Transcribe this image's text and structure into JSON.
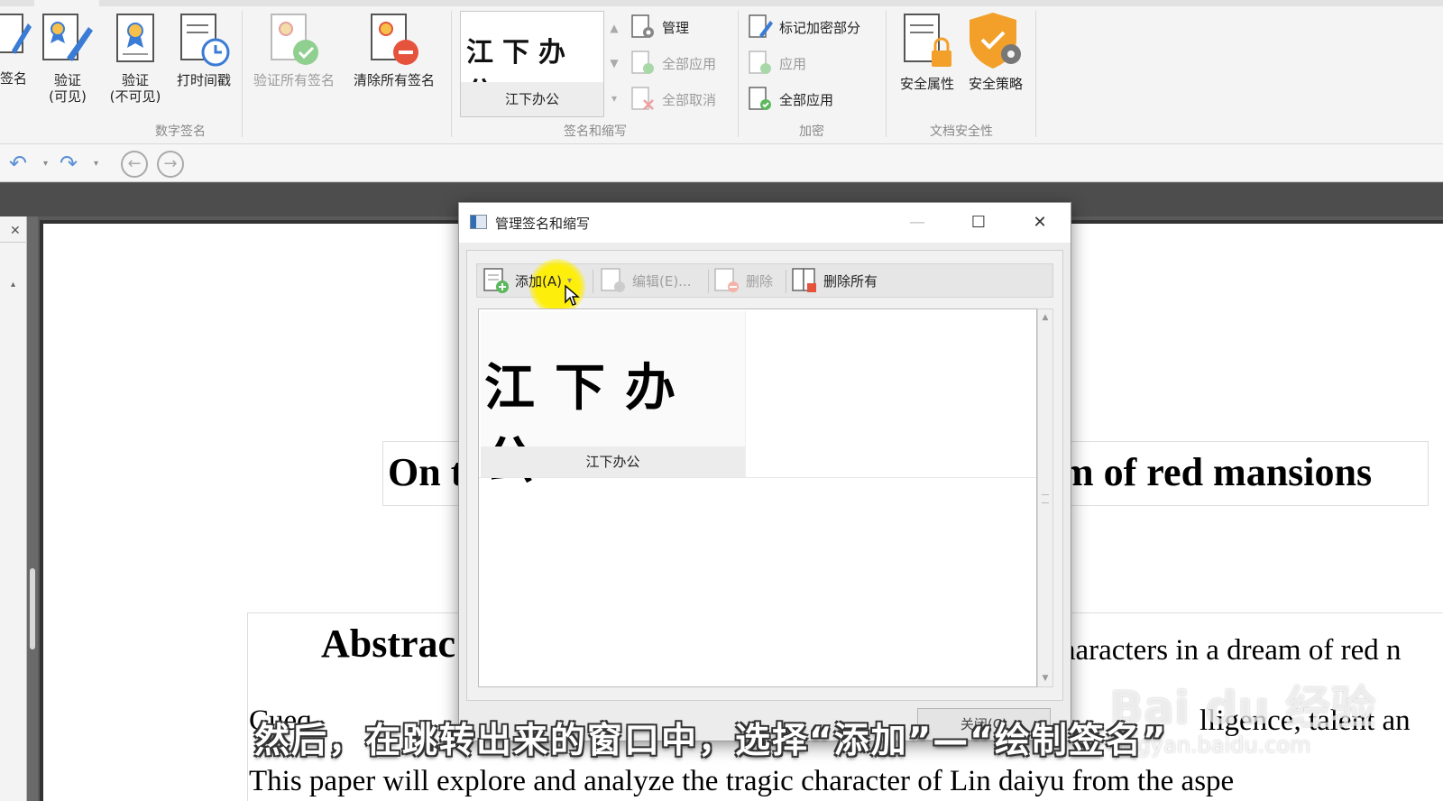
{
  "ribbon": {
    "buttons": {
      "sign": "签名",
      "verify_visible_1": "验证",
      "verify_visible_2": "(可见)",
      "verify_invisible_1": "验证",
      "verify_invisible_2": "(不可见)",
      "timestamp": "打时间戳",
      "verify_all": "验证所有签名",
      "clear_all": "清除所有签名"
    },
    "group_digital_signature": "数字签名",
    "gallery_signature_name": "江下办公",
    "gallery_signature_calligraphy": "江下办公",
    "manage": "管理",
    "apply_all_disabled": "全部应用",
    "cancel_all": "全部取消",
    "group_sign_initials": "签名和缩写",
    "mark_redaction": "标记加密部分",
    "apply": "应用",
    "apply_all": "全部应用",
    "group_encrypt": "加密",
    "security_properties": "安全属性",
    "security_policy": "安全策略",
    "group_doc_security": "文档安全性",
    "colors": {
      "accent_blue": "#2f6db4",
      "security_orange": "#f2a02a",
      "remove_red": "#e5533c",
      "verify_green": "#5bb85d"
    }
  },
  "document": {
    "title_left": "On t",
    "title_right": "m of red mansions",
    "abstract_heading": "Abstrac",
    "abstract_right": "haracters in a dream of red n",
    "line2_left": "Cueq",
    "line2_right": "lligence, talent an",
    "line3": "This paper will explore and analyze the tragic character of Lin daiyu from the aspe"
  },
  "dialog": {
    "title": "管理签名和缩写",
    "toolbar": {
      "add": "添加(A)",
      "edit": "编辑(E)...",
      "delete": "删除",
      "delete_all": "删除所有"
    },
    "list": {
      "items": [
        {
          "name": "江下办公",
          "calligraphy": "江下办公"
        }
      ]
    },
    "close": "关闭(C)"
  },
  "overlay": {
    "subtitle": "然后，在跳转出来的窗口中，选择“添加”—“绘制签名”",
    "watermark_main": "Bai du 经验",
    "watermark_url": "jingyan.baidu.com"
  }
}
